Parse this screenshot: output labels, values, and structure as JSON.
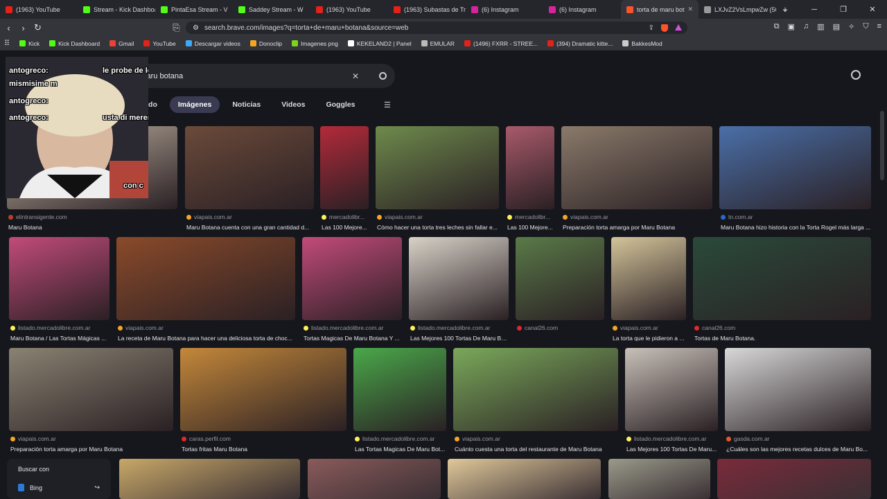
{
  "tabs": [
    {
      "label": "(1963) YouTube",
      "color": "#e62117"
    },
    {
      "label": "Stream - Kick Dashboard",
      "color": "#53fc18"
    },
    {
      "label": "PintaEsa Stream - V",
      "color": "#53fc18"
    },
    {
      "label": "Saddey Stream - W",
      "color": "#53fc18"
    },
    {
      "label": "(1963) YouTube",
      "color": "#e62117"
    },
    {
      "label": "(1963) Subastas de Tra",
      "color": "#e62117"
    },
    {
      "label": "(6) Instagram",
      "color": "#d6249f"
    },
    {
      "label": "(6) Instagram",
      "color": "#d6249f"
    },
    {
      "label": "torta de maru bot",
      "color": "#fb542b",
      "active": true
    },
    {
      "label": "LXJvZ2VsLmpwZw (50",
      "color": "#999999"
    }
  ],
  "address": {
    "url": "search.brave.com/images?q=torta+de+maru+botana&source=web"
  },
  "bookmarks": [
    {
      "label": "Kick",
      "color": "#53fc18"
    },
    {
      "label": "Kick Dashboard",
      "color": "#53fc18"
    },
    {
      "label": "Gmail",
      "color": "#ea4335"
    },
    {
      "label": "YouTube",
      "color": "#e62117"
    },
    {
      "label": "Descargar videos",
      "color": "#3fa9f5"
    },
    {
      "label": "Donoclip",
      "color": "#f5a623"
    },
    {
      "label": "Imagenes png",
      "color": "#7ed321"
    },
    {
      "label": "KEKELAND2 | Panel",
      "color": "#ffffff"
    },
    {
      "label": "EMULAR",
      "color": "#bbbbbb"
    },
    {
      "label": "(1496) FXRR - STREE...",
      "color": "#e62117"
    },
    {
      "label": "(394) Dramatic kitte...",
      "color": "#e62117"
    },
    {
      "label": "BakkesMod",
      "color": "#cccccc"
    }
  ],
  "search": {
    "query": "torta de maru botana"
  },
  "search_tabs": [
    "Todo",
    "Imágenes",
    "Noticias",
    "Videos",
    "Goggles"
  ],
  "stream_overlay": {
    "chat_lines": [
      "antogreco:",
      "le probe de le",
      "mismisime m",
      "antogreco:",
      "antogreco:",
      "usta di merengue"
    ],
    "cam_text": "con c"
  },
  "results": [
    {
      "source": "elintransigente.com",
      "title": "Maru Botana",
      "color": "#b8402a",
      "bg": "#c8b9a8"
    },
    {
      "source": "viapais.com.ar",
      "title": "Maru Botana cuenta con una gran cantidad d...",
      "color": "#f5a623",
      "bg": "#6b4a3a"
    },
    {
      "source": "mercadolibr...",
      "title": "Las 100 Mejore...",
      "color": "#fff159",
      "bg": "#b32a3a"
    },
    {
      "source": "viapais.com.ar",
      "title": "Cómo hacer una torta tres leches sin fallar e...",
      "color": "#f5a623",
      "bg": "#6e8a4c"
    },
    {
      "source": "mercadolibr...",
      "title": "Las 100 Mejore...",
      "color": "#fff159",
      "bg": "#a85a6a"
    },
    {
      "source": "viapais.com.ar",
      "title": "Preparación torta amarga por Maru Botana",
      "color": "#f5a623",
      "bg": "#8a7a6a"
    },
    {
      "source": "tn.com.ar",
      "title": "Maru Botana hizo historia con la Torta Rogel más larga ...",
      "color": "#2a66d0",
      "bg": "#4a6fa8"
    },
    {
      "source": "listado.mercadolibre.com.ar",
      "title": "Maru Botana / Las Tortas Mágicas ...",
      "color": "#fff159",
      "bg": "#c24b7a"
    },
    {
      "source": "viapais.com.ar",
      "title": "La receta de Maru Botana para hacer una deliciosa torta de choc...",
      "color": "#f5a623",
      "bg": "#8a4a2a"
    },
    {
      "source": "listado.mercadolibre.com.ar",
      "title": "Tortas Magicas De Maru Botana Y ...",
      "color": "#fff159",
      "bg": "#c24b7a"
    },
    {
      "source": "listado.mercadolibre.com.ar",
      "title": "Las Mejores 100 Tortas De Maru Bo...",
      "color": "#fff159",
      "bg": "#d9d2c8"
    },
    {
      "source": "canal26.com",
      "title": "",
      "color": "#e0282d",
      "bg": "#5a7a48"
    },
    {
      "source": "viapais.com.ar",
      "title": "La torta que le pidieron a ...",
      "color": "#f5a623",
      "bg": "#d4c49a"
    },
    {
      "source": "canal26.com",
      "title": "Tortas de Maru Botana.",
      "color": "#e0282d",
      "bg": "#2a4a3a"
    },
    {
      "source": "viapais.com.ar",
      "title": "Preparación torta amarga por Maru Botana",
      "color": "#f5a623",
      "bg": "#8a8272"
    },
    {
      "source": "caras.perfil.com",
      "title": "Tortas fritas Maru Botana",
      "color": "#e0282d",
      "bg": "#c4883a"
    },
    {
      "source": "listado.mercadolibre.com.ar",
      "title": "Las Tortas Magicas De Maru Bot...",
      "color": "#fff159",
      "bg": "#4aa84a"
    },
    {
      "source": "viapais.com.ar",
      "title": "Cuánto cuesta una torta del restaurante de Maru Botana",
      "color": "#f5a623",
      "bg": "#7aa85a"
    },
    {
      "source": "listado.mercadolibre.com.ar",
      "title": "Las Mejores 100 Tortas De Maru...",
      "color": "#fff159",
      "bg": "#c8c0b8"
    },
    {
      "source": "gasda.com.ar",
      "title": "¿Cuáles son las mejores recetas dulces de Maru Bo...",
      "color": "#e05a2a",
      "bg": "#d8d8d8"
    }
  ],
  "bottom_images": [
    {
      "bg": "#c8a868"
    },
    {
      "bg": "#8a5a5a"
    },
    {
      "bg": "#e0c89a"
    },
    {
      "bg": "#9a9a8a"
    },
    {
      "bg": "#7a2a3a"
    }
  ],
  "buscar": {
    "label": "Buscar con",
    "engine": "Bing"
  }
}
